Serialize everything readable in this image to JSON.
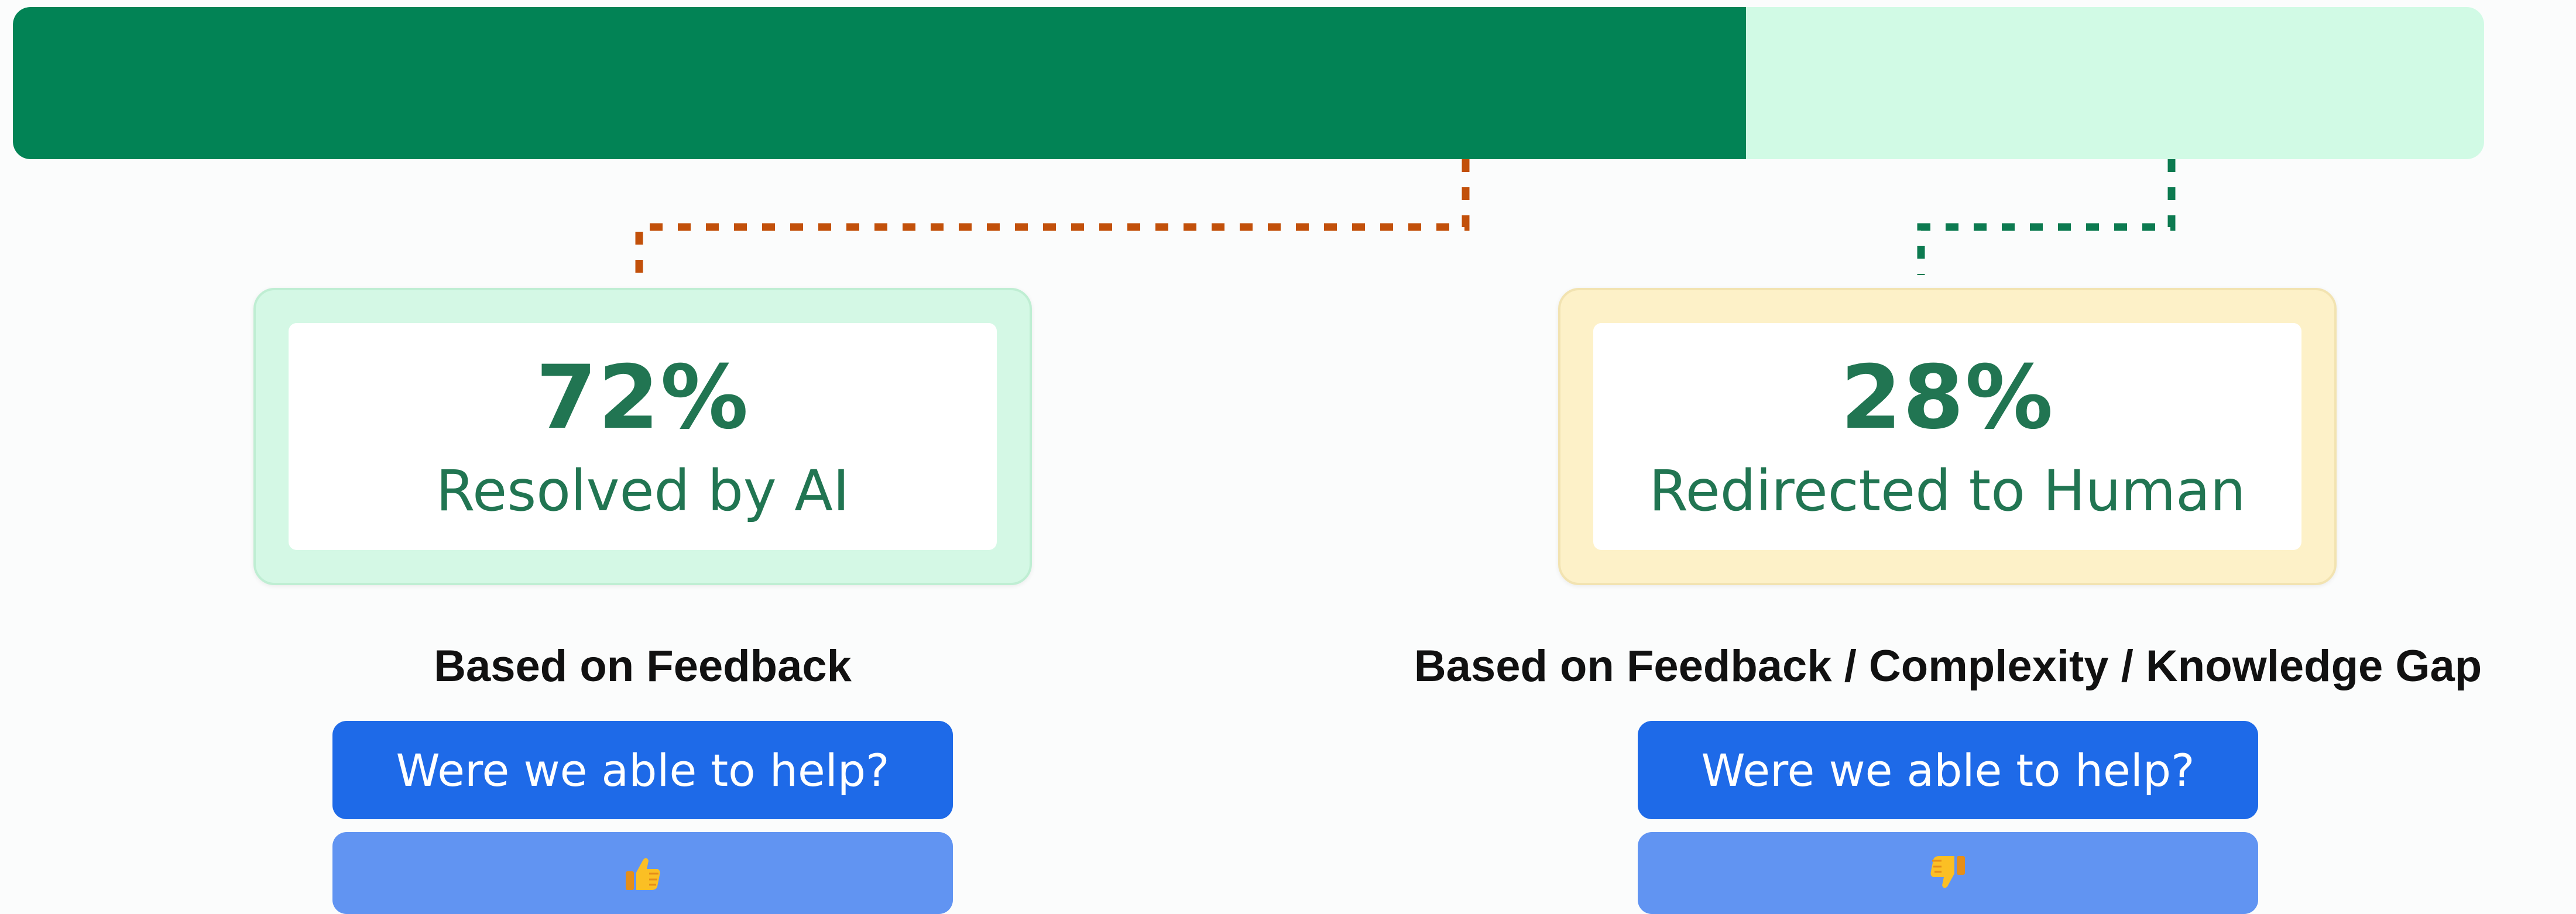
{
  "colors": {
    "resolved": "#028355",
    "redirected": "#d1fae5",
    "connector_ai": "#c2500a",
    "connector_human": "#0c7a50",
    "button": "#1e6ae8",
    "vote_button": "#6194f2"
  },
  "progress": {
    "resolved_fraction": 0.72,
    "redirected_fraction": 0.28
  },
  "resolved": {
    "percent": "72%",
    "label": "Resolved by AI",
    "caption": "Based on Feedback",
    "help_button": "Were we able to help?",
    "vote_icon": "thumbs-up-icon"
  },
  "redirected": {
    "percent": "28%",
    "label": "Redirected to Human",
    "caption": "Based on Feedback / Complexity / Knowledge Gap",
    "help_button": "Were we able to help?",
    "vote_icon": "thumbs-down-icon"
  }
}
